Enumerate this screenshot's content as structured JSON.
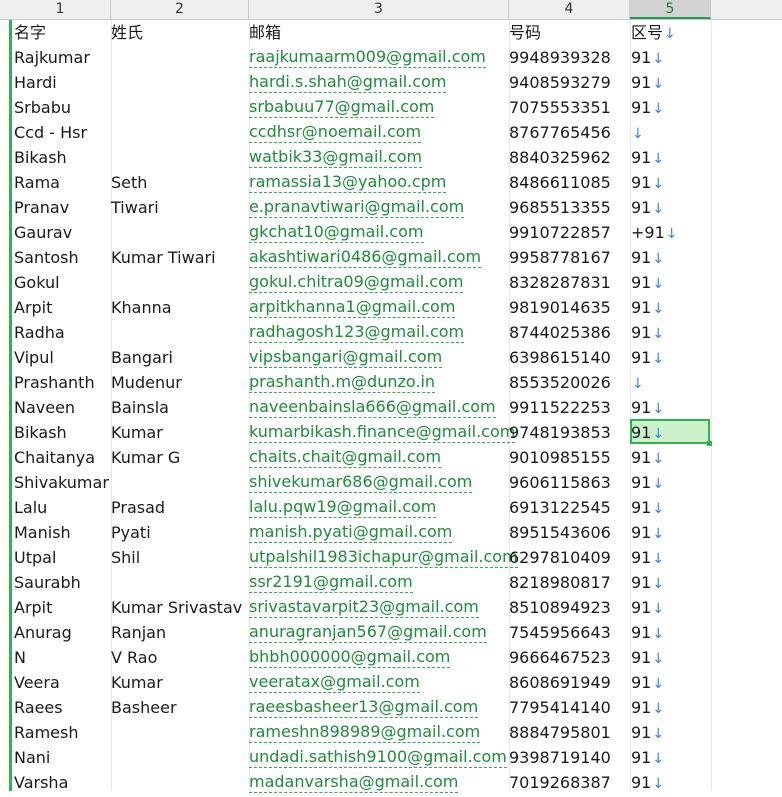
{
  "col_headers": [
    "1",
    "2",
    "3",
    "4",
    "5"
  ],
  "header_row": {
    "name": "名字",
    "surname": "姓氏",
    "email": "邮箱",
    "phone": "号码",
    "code": "区号"
  },
  "rows": [
    {
      "name": "Rajkumar",
      "surname": "",
      "email": "raajkumaarm009@gmail.com",
      "phone": "9948939328",
      "code": "91"
    },
    {
      "name": "Hardi",
      "surname": "",
      "email": "hardi.s.shah@gmail.com",
      "phone": "9408593279",
      "code": "91"
    },
    {
      "name": "Srbabu",
      "surname": "",
      "email": "srbabuu77@gmail.com",
      "phone": "7075553351",
      "code": "91"
    },
    {
      "name": "Ccd - Hsr",
      "surname": "",
      "email": "ccdhsr@noemail.com",
      "phone": "8767765456",
      "code": ""
    },
    {
      "name": "Bikash",
      "surname": "",
      "email": "watbik33@gmail.com",
      "phone": "8840325962",
      "code": "91"
    },
    {
      "name": "Rama",
      "surname": "Seth",
      "email": "ramassia13@yahoo.cpm",
      "phone": "8486611085",
      "code": "91"
    },
    {
      "name": "Pranav",
      "surname": "Tiwari",
      "email": "e.pranavtiwari@gmail.com",
      "phone": "9685513355",
      "code": "91"
    },
    {
      "name": "Gaurav",
      "surname": "",
      "email": "gkchat10@gmail.com",
      "phone": "9910722857",
      "code": "+91"
    },
    {
      "name": "Santosh",
      "surname": "Kumar Tiwari",
      "email": "akashtiwari0486@gmail.com",
      "phone": "9958778167",
      "code": "91"
    },
    {
      "name": "Gokul",
      "surname": "",
      "email": "gokul.chitra09@gmail.com",
      "phone": "8328287831",
      "code": "91"
    },
    {
      "name": "Arpit",
      "surname": "Khanna",
      "email": "arpitkhanna1@gmail.com",
      "phone": "9819014635",
      "code": "91"
    },
    {
      "name": "Radha",
      "surname": "",
      "email": "radhagosh123@gmail.com",
      "phone": "8744025386",
      "code": "91"
    },
    {
      "name": "Vipul",
      "surname": "Bangari",
      "email": "vipsbangari@gmail.com",
      "phone": "6398615140",
      "code": "91"
    },
    {
      "name": "Prashanth",
      "surname": "Mudenur",
      "email": "prashanth.m@dunzo.in",
      "phone": "8553520026",
      "code": ""
    },
    {
      "name": "Naveen",
      "surname": "Bainsla",
      "email": "naveenbainsla666@gmail.com",
      "phone": "9911522253",
      "code": "91"
    },
    {
      "name": "Bikash",
      "surname": "Kumar",
      "email": "kumarbikash.finance@gmail.com",
      "phone": "9748193853",
      "code": "91"
    },
    {
      "name": "Chaitanya",
      "surname": "Kumar G",
      "email": "chaits.chait@gmail.com",
      "phone": "9010985155",
      "code": "91"
    },
    {
      "name": "Shivakumar",
      "surname": "",
      "email": "shivekumar686@gmail.com",
      "phone": "9606115863",
      "code": "91"
    },
    {
      "name": "Lalu",
      "surname": "Prasad",
      "email": "lalu.pqw19@gmail.com",
      "phone": "6913122545",
      "code": "91"
    },
    {
      "name": "Manish",
      "surname": "Pyati",
      "email": "manish.pyati@gmail.com",
      "phone": "8951543606",
      "code": "91"
    },
    {
      "name": "Utpal",
      "surname": "Shil",
      "email": "utpalshil1983ichapur@gmail.com",
      "phone": "6297810409",
      "code": "91"
    },
    {
      "name": "Saurabh",
      "surname": "",
      "email": "ssr2191@gmail.com",
      "phone": "8218980817",
      "code": "91"
    },
    {
      "name": "Arpit",
      "surname": "Kumar Srivastav",
      "email": "srivastavarpit23@gmail.com",
      "phone": "8510894923",
      "code": "91"
    },
    {
      "name": "Anurag",
      "surname": "Ranjan",
      "email": "anuragranjan567@gmail.com",
      "phone": "7545956643",
      "code": "91"
    },
    {
      "name": "N",
      "surname": "V Rao",
      "email": "bhbh000000@gmail.com",
      "phone": "9666467523",
      "code": "91"
    },
    {
      "name": "Veera",
      "surname": "Kumar",
      "email": "veeratax@gmail.com",
      "phone": "8608691949",
      "code": "91"
    },
    {
      "name": "Raees",
      "surname": "Basheer",
      "email": "raeesbasheer13@gmail.com",
      "phone": "7795414140",
      "code": "91"
    },
    {
      "name": "Ramesh",
      "surname": "",
      "email": "rameshn898989@gmail.com",
      "phone": "8884795801",
      "code": "91"
    },
    {
      "name": "Nani",
      "surname": "",
      "email": "undadi.sathish9100@gmail.com",
      "phone": "9398719140",
      "code": "91"
    },
    {
      "name": "Varsha",
      "surname": "",
      "email": "madanvarsha@gmail.com",
      "phone": "7019268387",
      "code": "91"
    }
  ],
  "arrow_glyph": "↓",
  "selected_cell": {
    "row": 16,
    "col": 5
  },
  "colors": {
    "accent": "#2fb24f",
    "email": "#1e8c3a",
    "arrow": "#3b82f6",
    "selection_fill": "#ccf2cc"
  }
}
